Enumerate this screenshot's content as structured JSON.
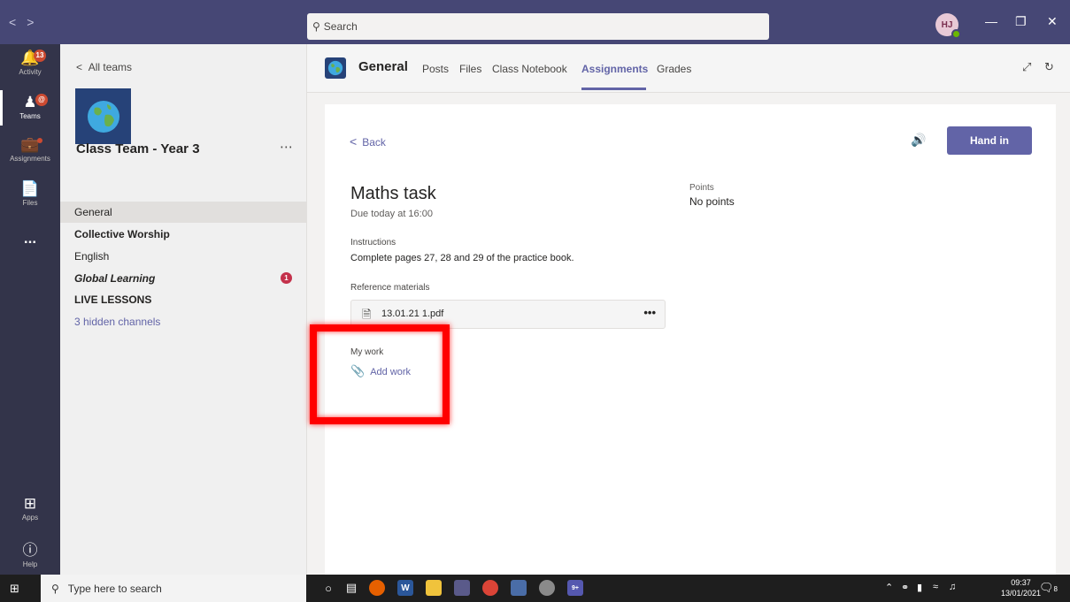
{
  "titlebar": {
    "nav_back": "<",
    "nav_forward": ">",
    "search_placeholder": "Search",
    "avatar_initials": "HJ",
    "minimize": "—",
    "maximize": "❐",
    "close": "✕"
  },
  "rail": {
    "items": [
      {
        "label": "Activity",
        "icon": "bell-icon",
        "badge": "13"
      },
      {
        "label": "Teams",
        "icon": "teams-icon",
        "badge": "@"
      },
      {
        "label": "Assignments",
        "icon": "assignments-icon"
      },
      {
        "label": "Files",
        "icon": "files-icon"
      },
      {
        "label": "...",
        "icon": "more-icon"
      },
      {
        "label": "Apps",
        "icon": "apps-icon"
      },
      {
        "label": "Help",
        "icon": "help-icon"
      }
    ]
  },
  "teampanel": {
    "all_teams": "All teams",
    "team_name": "Class Team - Year 3",
    "more": "⋯",
    "channels": [
      {
        "label": "General",
        "selected": true
      },
      {
        "label": "Collective Worship",
        "bold": true
      },
      {
        "label": "English"
      },
      {
        "label": "Global Learning",
        "bold": true,
        "italic": true,
        "count": "1"
      },
      {
        "label": "LIVE LESSONS",
        "bold": true
      },
      {
        "label": "3 hidden channels",
        "link": true
      }
    ]
  },
  "header": {
    "title": "General",
    "tabs": [
      "Posts",
      "Files",
      "Class Notebook",
      "Assignments",
      "Grades"
    ],
    "active_tab": "Assignments"
  },
  "assignment": {
    "back_label": "Back",
    "hand_in_label": "Hand in",
    "title": "Maths task",
    "due": "Due today at 16:00",
    "points_label": "Points",
    "points_value": "No points",
    "instructions_label": "Instructions",
    "instructions_text": "Complete pages 27, 28 and 29 of the practice book.",
    "reference_label": "Reference materials",
    "reference_file": "13.01.21 1.pdf",
    "file_more": "•••",
    "my_work_label": "My work",
    "add_work_label": "Add work"
  },
  "taskbar": {
    "search_placeholder": "Type here to search",
    "teams_badge": "9+",
    "time": "09:37",
    "date": "13/01/2021",
    "notification_count": "8"
  },
  "colors": {
    "titlebar": "#464775",
    "rail": "#33344a",
    "accent": "#6264a7",
    "highlight": "#ff0000"
  }
}
